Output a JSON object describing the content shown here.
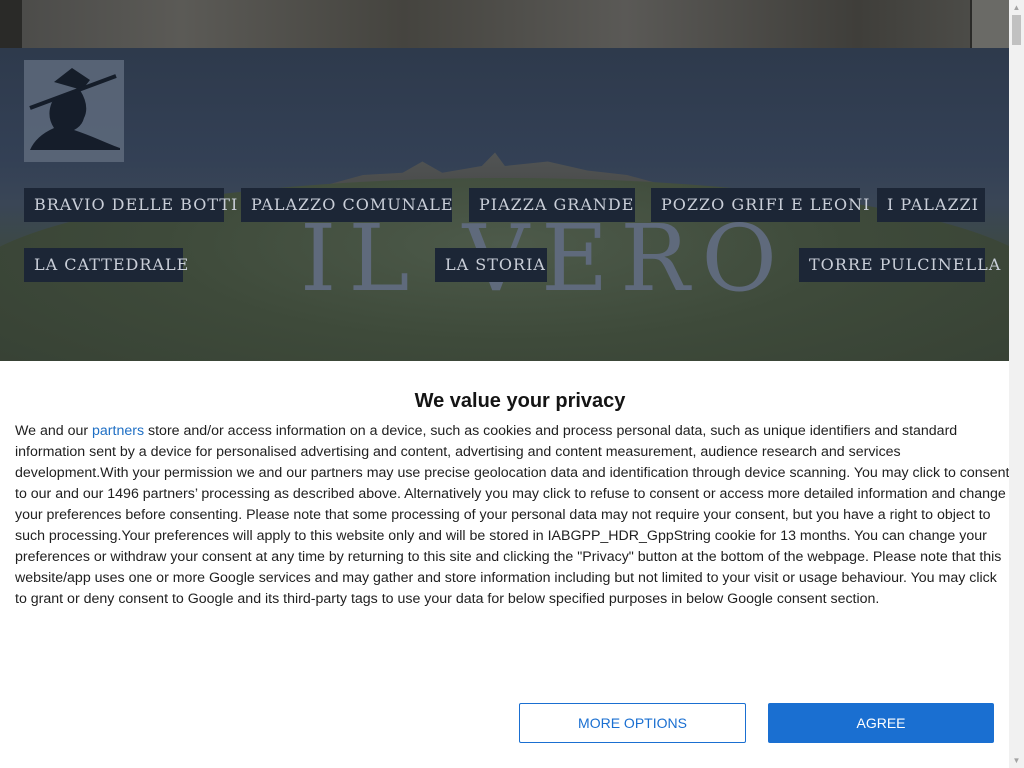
{
  "hero": {
    "title": "IL VERO",
    "logo_icon": "hat-silhouette-icon"
  },
  "nav": [
    {
      "label": "BRAVIO DELLE BOTTI"
    },
    {
      "label": "PALAZZO COMUNALE"
    },
    {
      "label": "PIAZZA GRANDE"
    },
    {
      "label": "POZZO GRIFI E LEONI"
    },
    {
      "label": "I PALAZZI"
    },
    {
      "label": "LA CATTEDRALE"
    },
    {
      "label": "LA STORIA"
    },
    {
      "label": "TORRE PULCINELLA"
    }
  ],
  "consent": {
    "title": "We value your privacy",
    "intro": "We and our ",
    "partners_link": "partners",
    "body": " store and/or access information on a device, such as cookies and process personal data, such as unique identifiers and standard information sent by a device for personalised advertising and content, advertising and content measurement, audience research and services development.With your permission we and our partners may use precise geolocation data and identification through device scanning. You may click to consent to our and our 1496 partners’ processing as described above. Alternatively you may click to refuse to consent or access more detailed information and change your preferences before consenting. Please note that some processing of your personal data may not require your consent, but you have a right to object to such processing.Your preferences will apply to this website only and will be stored in IABGPP_HDR_GppString cookie for 13 months. You can change your preferences or withdraw your consent at any time by returning to this site and clicking the \"Privacy\" button at the bottom of the webpage. Please note that this website/app uses one or more Google services and may gather and store information including but not limited to your visit or usage behaviour. You may click to grant or deny consent to Google and its third-party tags to use your data for below specified purposes in below Google consent section.",
    "more_options_label": "MORE OPTIONS",
    "agree_label": "AGREE"
  },
  "colors": {
    "accent": "#1a6fd1",
    "nav_bg": "#1c2636",
    "hero_bg": "#334055"
  }
}
